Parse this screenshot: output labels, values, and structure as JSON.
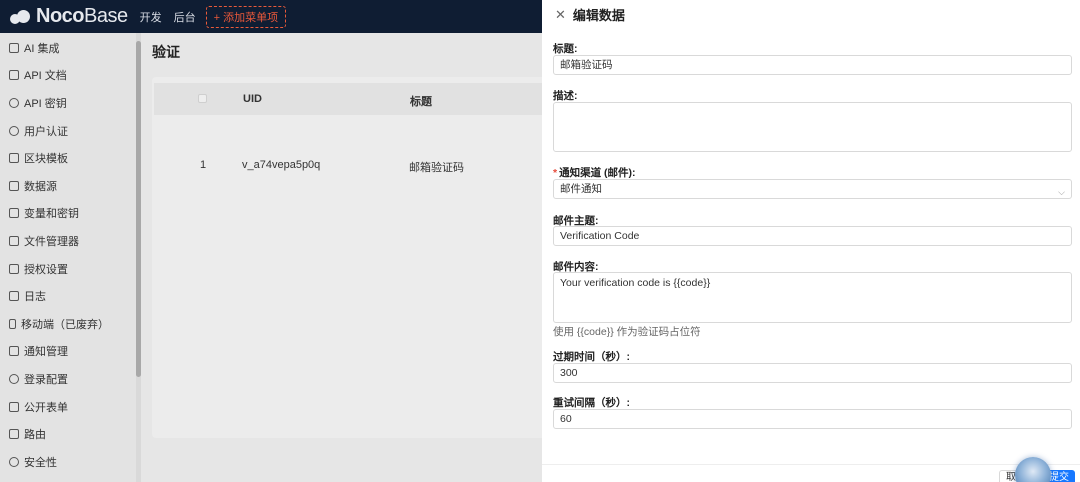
{
  "topbar": {
    "logo_bold": "Noco",
    "logo_light": "Base",
    "links": [
      "开发",
      "后台"
    ],
    "add_menu_label": "+ 添加菜单项"
  },
  "sidebar": {
    "items": [
      {
        "label": "AI 集成",
        "icon": "robot-icon"
      },
      {
        "label": "API 文档",
        "icon": "document-icon"
      },
      {
        "label": "API 密钥",
        "icon": "key-icon"
      },
      {
        "label": "用户认证",
        "icon": "login-icon"
      },
      {
        "label": "区块模板",
        "icon": "template-icon"
      },
      {
        "label": "数据源",
        "icon": "database-icon"
      },
      {
        "label": "变量和密钥",
        "icon": "table-icon"
      },
      {
        "label": "文件管理器",
        "icon": "file-icon"
      },
      {
        "label": "授权设置",
        "icon": "license-icon"
      },
      {
        "label": "日志",
        "icon": "log-icon"
      },
      {
        "label": "移动端（已废弃）",
        "icon": "mobile-icon"
      },
      {
        "label": "通知管理",
        "icon": "megaphone-icon"
      },
      {
        "label": "登录配置",
        "icon": "gear-icon"
      },
      {
        "label": "公开表单",
        "icon": "table-icon"
      },
      {
        "label": "路由",
        "icon": "route-icon"
      },
      {
        "label": "安全性",
        "icon": "shield-icon"
      }
    ]
  },
  "main": {
    "title": "验证",
    "table": {
      "columns": [
        "UID",
        "标题"
      ],
      "rows": [
        {
          "index": "1",
          "uid": "v_a74vepa5p0q",
          "title": "邮箱验证码"
        }
      ]
    }
  },
  "drawer": {
    "title": "编辑数据",
    "fields": {
      "title_label": "标题:",
      "title_value": "邮箱验证码",
      "desc_label": "描述:",
      "desc_value": "",
      "channel_label": "通知渠道 (邮件):",
      "channel_value": "邮件通知",
      "subject_label": "邮件主题:",
      "subject_value": "Verification Code",
      "content_label": "邮件内容:",
      "content_value": "Your verification code is {{code}}",
      "content_help": "使用 {{code}} 作为验证码占位符",
      "expire_label": "过期时间（秒）:",
      "expire_value": "300",
      "retry_label": "重试间隔（秒）:",
      "retry_value": "60"
    },
    "cancel_label": "取消",
    "submit_label": "提交"
  },
  "colors": {
    "topbar": "#0f1d33",
    "accent_red": "#e8583a",
    "primary": "#1677ff"
  }
}
